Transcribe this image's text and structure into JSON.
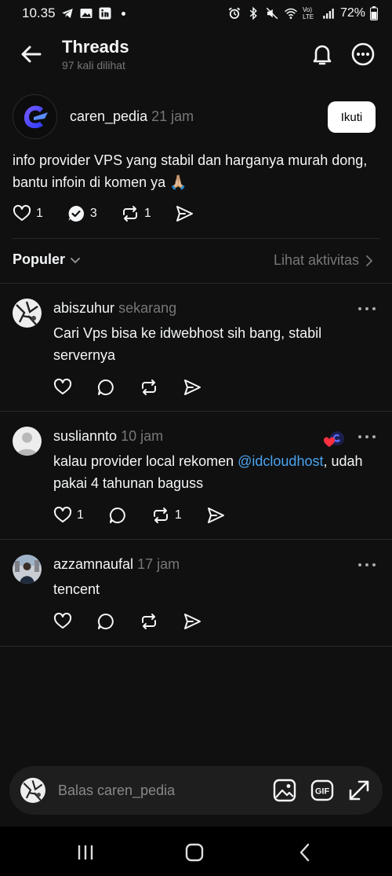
{
  "status_bar": {
    "time": "10.35",
    "battery": "72%",
    "network": "Vo) LTE"
  },
  "header": {
    "title": "Threads",
    "subtitle": "97 kali dilihat"
  },
  "post": {
    "username": "caren_pedia",
    "time": "21 jam",
    "follow_label": "Ikuti",
    "body": "info provider VPS yang stabil dan harganya murah dong, bantu infoin di komen ya 🙏🏼",
    "likes": "1",
    "replies": "3",
    "reposts": "1"
  },
  "sort": {
    "label": "Populer",
    "activity_link": "Lihat aktivitas"
  },
  "replies": [
    {
      "username": "abiszuhur",
      "time": "sekarang",
      "body": "Cari Vps bisa ke idwebhost sih bang, stabil servernya",
      "likes": "",
      "reposts": ""
    },
    {
      "username": "susliannto",
      "time": "10 jam",
      "body_prefix": "kalau provider local rekomen ",
      "mention": "@idcloudhost",
      "body_suffix": ", udah pakai 4 tahunan baguss",
      "likes": "1",
      "reposts": "1"
    },
    {
      "username": "azzamnaufal",
      "time": "17 jam",
      "body": "tencent",
      "likes": "",
      "reposts": ""
    }
  ],
  "composer": {
    "placeholder": "Balas caren_pedia"
  },
  "colors": {
    "background": "#101010",
    "text": "#f3f5f7",
    "muted": "#777777",
    "mention": "#4aa3f0",
    "divider": "#2a2a2a",
    "liked": "#ff3040"
  },
  "icons": {
    "back": "arrow-left-icon",
    "notifications": "bell-icon",
    "more": "more-circle-icon",
    "like": "heart-icon",
    "reply": "comment-icon",
    "repost": "repost-icon",
    "share": "send-icon",
    "image": "image-icon",
    "gif": "gif-icon",
    "expand": "expand-icon"
  }
}
